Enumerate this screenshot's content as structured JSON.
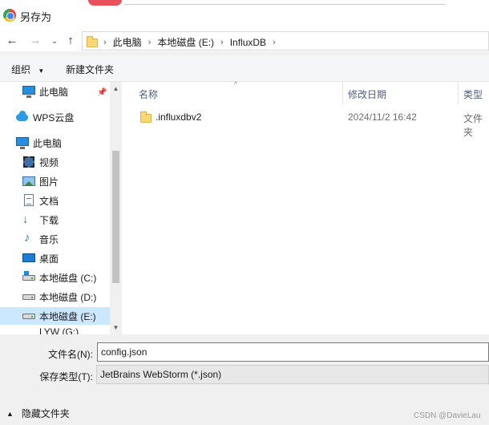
{
  "window": {
    "title": "另存为"
  },
  "address": {
    "crumbs": [
      "此电脑",
      "本地磁盘 (E:)",
      "InfluxDB"
    ]
  },
  "toolbar": {
    "organize": "组织",
    "new_folder": "新建文件夹"
  },
  "nav": {
    "items": [
      {
        "label": "此电脑",
        "icon": "monitor-icon"
      },
      {
        "label": "WPS云盘",
        "icon": "cloud-icon"
      },
      {
        "label": "此电脑",
        "icon": "monitor-icon"
      },
      {
        "label": "视频",
        "icon": "video-icon"
      },
      {
        "label": "图片",
        "icon": "picture-icon"
      },
      {
        "label": "文档",
        "icon": "document-icon"
      },
      {
        "label": "下载",
        "icon": "download-icon"
      },
      {
        "label": "音乐",
        "icon": "music-icon"
      },
      {
        "label": "桌面",
        "icon": "desktop-icon"
      },
      {
        "label": "本地磁盘 (C:)",
        "icon": "drive-icon"
      },
      {
        "label": "本地磁盘 (D:)",
        "icon": "drive-icon"
      },
      {
        "label": "本地磁盘 (E:)",
        "icon": "drive-icon"
      },
      {
        "label": "LYW (G:)",
        "icon": "drive-icon"
      }
    ],
    "selected": "本地磁盘 (E:)"
  },
  "columns": {
    "name": "名称",
    "modified": "修改日期",
    "type": "类型"
  },
  "files": [
    {
      "name": ".influxdbv2",
      "modified": "2024/11/2 16:42",
      "type": "文件夹"
    }
  ],
  "form": {
    "filename_label": "文件名(N):",
    "filename_value": "config.json",
    "filetype_label": "保存类型(T):",
    "filetype_value": "JetBrains WebStorm (*.json)"
  },
  "footer": {
    "hide_folders": "隐藏文件夹",
    "watermark": "CSDN @DavieLau"
  }
}
